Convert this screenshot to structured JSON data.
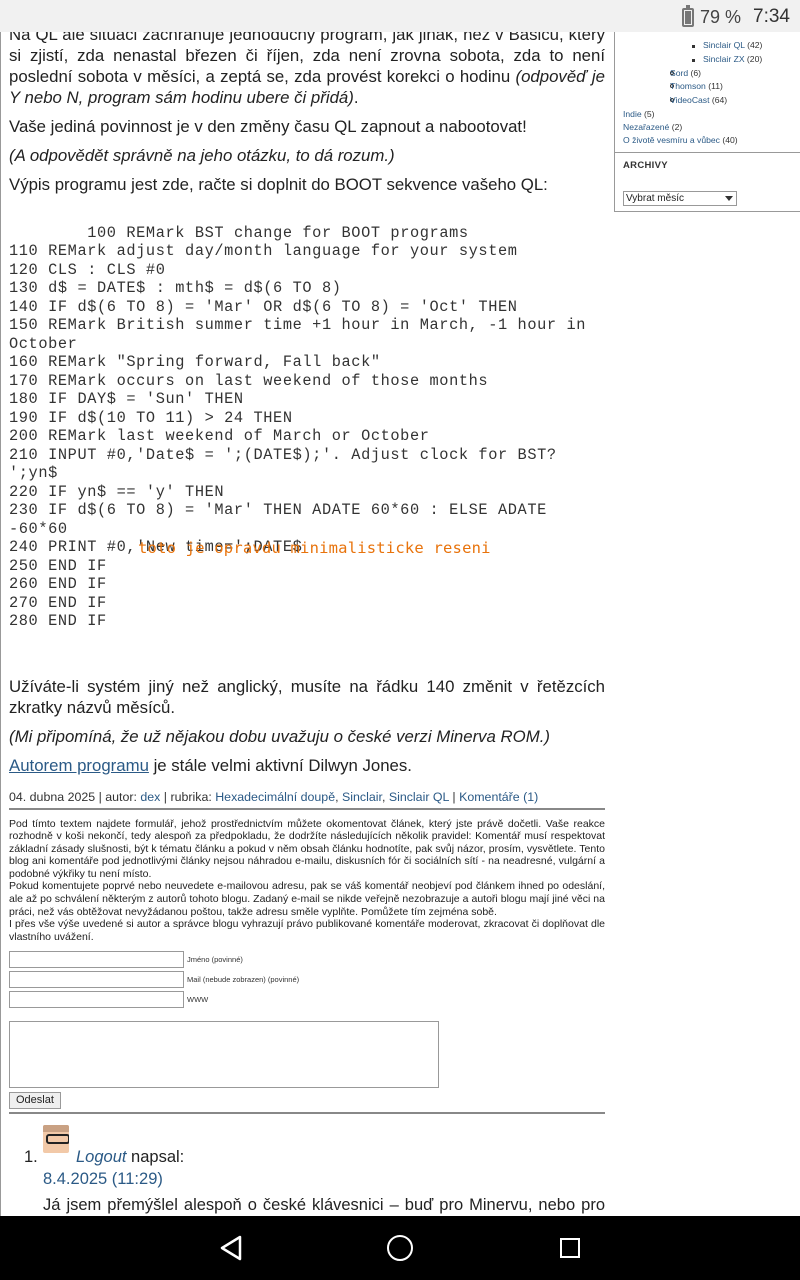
{
  "status": {
    "battery": "79 %",
    "time": "7:34"
  },
  "article": {
    "p1_a": "Na QL ale situaci zachraňuje jednoduchý program, jak jinak, než v Basicu, který si zjistí, zda nenastal březen či říjen, zda není zrovna sobota, zda to není poslední sobota v měsíci, a zeptá se, zda provést korekci o hodinu ",
    "p1_b": "(odpověď je Y nebo N, program sám hodinu ubere či přidá)",
    "p1_c": ".",
    "p2": "Vaše jediná povinnost je v den změny času QL zapnout a nabootovat!",
    "p3": "(A odpovědět správně na jeho otázku, to dá rozum.)",
    "p4": "Výpis programu jest zde, račte si doplnit do BOOT sekvence vašeho QL:",
    "code": "100 REMark BST change for BOOT programs\n110 REMark adjust day/month language for your system\n120 CLS : CLS #0\n130 d$ = DATE$ : mth$ = d$(6 TO 8)\n140 IF d$(6 TO 8) = 'Mar' OR d$(6 TO 8) = 'Oct' THEN\n150 REMark British summer time +1 hour in March, -1 hour in October\n160 REMark \"Spring forward, Fall back\"\n170 REMark occurs on last weekend of those months\n180 IF DAY$ = 'Sun' THEN\n190 IF d$(10 TO 11) > 24 THEN\n200 REMark last weekend of March or October\n210 INPUT #0,'Date$ = ';(DATE$);'. Adjust clock for BST? ';yn$\n220 IF yn$ == 'y' THEN\n230 IF d$(6 TO 8) = 'Mar' THEN ADATE 60*60 : ELSE ADATE -60*60\n240 PRINT #0,'New time=';DATE$\n250 END IF\n260 END IF\n270 END IF\n280 END IF",
    "annotation": "toto je opravdu minimalisticke reseni",
    "p5": "Užíváte-li systém jiný než anglický, musíte na řádku 140 změnit v řetězcích zkratky názvů měsíců.",
    "p6": "(Mi připomíná, že už nějakou dobu uvažuju o české verzi Minerva ROM.)",
    "p7_link": "Autorem programu",
    "p7_rest": " je stále velmi aktivní Dilwyn Jones."
  },
  "meta": {
    "date": "04. dubna 2025",
    "author_label": " | autor: ",
    "author": "dex",
    "rubrika_label": " | rubrika: ",
    "cat1": "Hexadecimální doupě",
    "cat2": "Sinclair",
    "cat3": "Sinclair QL",
    "comments": "Komentáře (1)",
    "sep_comma": ", ",
    "sep_bar": " | "
  },
  "form": {
    "rules1": "Pod tímto textem najdete formulář, jehož prostřednictvím můžete okomentovat článek, který jste právě dočetli. Vaše reakce rozhodně v koši nekončí, tedy alespoň za předpokladu, že dodržíte následujících několik pravidel: Komentář musí respektovat základní zásady slušnosti, být k tématu článku a pokud v něm obsah článku hodnotíte, pak svůj názor, prosím, vysvětlete. Tento blog ani komentáře pod jednotlivými články nejsou náhradou e-mailu, diskusních fór či sociálních sítí - na neadresné, vulgární a podobné výkřiky tu není místo.",
    "rules2": "Pokud komentujete poprvé nebo neuvedete e-mailovou adresu, pak se váš komentář neobjeví pod článkem ihned po odeslání, ale až po schválení některým z autorů tohoto blogu. Zadaný e-mail se nikde veřejně nezobrazuje a autoři blogu mají jiné věci na práci, než vás obtěžovat nevyžádanou poštou, takže adresu směle vyplňte. Pomůžete tím zejména sobě.",
    "rules3": "I přes vše výše uvedené si autor a správce blogu vyhrazují právo publikované komentáře moderovat, zkracovat či doplňovat dle vlastního uvážení.",
    "name_label": "Jméno (povinné)",
    "mail_label": "Mail (nebude zobrazen) (povinné)",
    "www_label": "WWW",
    "submit": "Odeslat"
  },
  "comment": {
    "number": "1.",
    "author": "Logout",
    "wrote": " napsal:",
    "date": "8.4.2025 (11:29)",
    "text": "Já jsem přemýšlel alespoň o české klávesnici – buď pro Minervu, nebo pro SMSQ/E nebo pro oboje. Ale na QL fóru mi ani nikdo nebyl schopen říct, jak přesně se uživatelsky definovaná klávesnice tvoří (návod na SMSQ/E jsem našel ve starém časopise, leč ten návod je na komplet"
  },
  "sidebar": {
    "items": [
      {
        "label": "Sinclair QL",
        "count": " (42)"
      },
      {
        "label": "Sinclair ZX",
        "count": " (20)"
      },
      {
        "label": "Sord",
        "count": " (6)"
      },
      {
        "label": "Thomson",
        "count": " (11)"
      },
      {
        "label": "VideoCast",
        "count": " (64)"
      },
      {
        "label": "Indie",
        "count": " (5)"
      },
      {
        "label": "Nezařazené",
        "count": " (2)"
      },
      {
        "label": "O životě vesmíru a vůbec",
        "count": " (40)"
      }
    ],
    "archive_title": "ARCHIVY",
    "archive_select": "Vybrat měsíc"
  }
}
